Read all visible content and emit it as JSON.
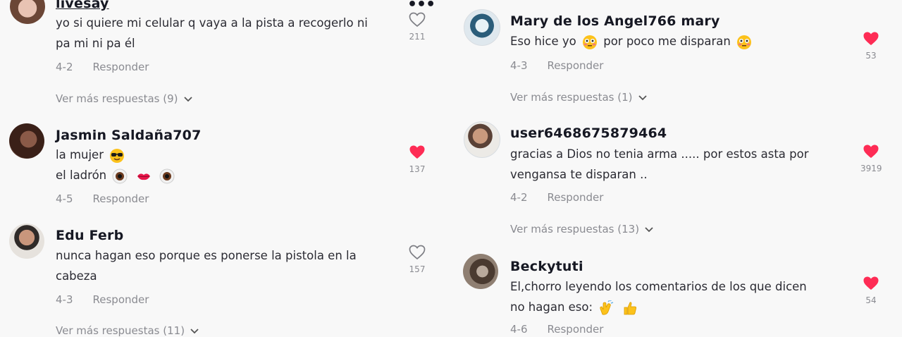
{
  "left": [
    {
      "name": "livesay",
      "lines": [
        "yo si quiere mi celular q vaya a la pista a recogerlo ni",
        "pa mi ni pa él"
      ],
      "date": "4-2",
      "reply": "Responder",
      "likes": "211",
      "liked": false,
      "more": "Ver más respuestas (9)"
    },
    {
      "name": "Jasmin Saldaña707",
      "lines": [
        "la mujer",
        "el ladrón"
      ],
      "date": "4-5",
      "reply": "Responder",
      "likes": "137",
      "liked": true
    },
    {
      "name": "Edu Ferb",
      "lines": [
        "nunca hagan eso porque es ponerse la pistola en la",
        "cabeza"
      ],
      "date": "4-3",
      "reply": "Responder",
      "likes": "157",
      "liked": false,
      "more": "Ver más respuestas (11)"
    }
  ],
  "right": [
    {
      "name": "Mary de los Angel766 mary",
      "line_a": "Eso hice yo",
      "line_b": "por poco me disparan",
      "date": "4-3",
      "reply": "Responder",
      "likes": "53",
      "liked": true,
      "more": "Ver más respuestas (1)"
    },
    {
      "name": "user6468675879464",
      "lines": [
        "gracias a Dios no tenia arma ..... por estos asta por",
        "vengansa te disparan .."
      ],
      "date": "4-2",
      "reply": "Responder",
      "likes": "3919",
      "liked": true,
      "more": "Ver más respuestas (13)"
    },
    {
      "name": "Beckytuti",
      "lines": [
        "El,chorro leyendo los comentarios de los que dicen",
        "no hagan eso:"
      ],
      "date": "4-6",
      "reply": "Responder",
      "likes": "54",
      "liked": true
    }
  ],
  "colors": {
    "heart_liked": "#fe2c55",
    "muted": "#8a8b91"
  },
  "icons": {
    "liked": "heart-filled-icon",
    "unliked": "heart-outline-icon",
    "more": "chevron-down-icon"
  }
}
